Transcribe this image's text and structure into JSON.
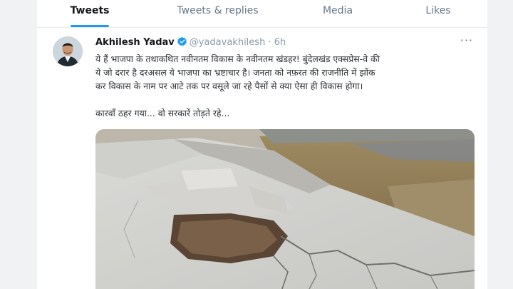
{
  "tabs": [
    {
      "label": "Tweets",
      "active": true
    },
    {
      "label": "Tweets & replies",
      "active": false
    },
    {
      "label": "Media",
      "active": false
    },
    {
      "label": "Likes",
      "active": false
    }
  ],
  "tweet": {
    "author": "Akhilesh Yadav",
    "verified": true,
    "handle": "@yadavakhilesh",
    "separator": "·",
    "time": "6h",
    "more": "···",
    "text_lines": [
      "ये हैं भाजपा के तथाकथित नवीनतम विकास के नवीनतम खंडहर! बुंदेलखंड एक्सप्रेस-वे की",
      "ये जो दरार है दरअसल ये भाजपा का भ्रष्टाचार है। जनता को नफ़रत की राजनीति में झोंक",
      "कर विकास के नाम पर आटे तक पर वसूले जा रहे पैसों से क्या ऐसा ही विकास होगा।"
    ],
    "second_line": "कारवाँ ठहर गया... वो सरकारें तोड़ते रहे...",
    "media_icon": "photo-of-cracked-road-icon"
  },
  "colors": {
    "accent": "#1d9bf0",
    "verified": "#1d9bf0",
    "text": "#14171a",
    "muted": "#8899a6"
  }
}
